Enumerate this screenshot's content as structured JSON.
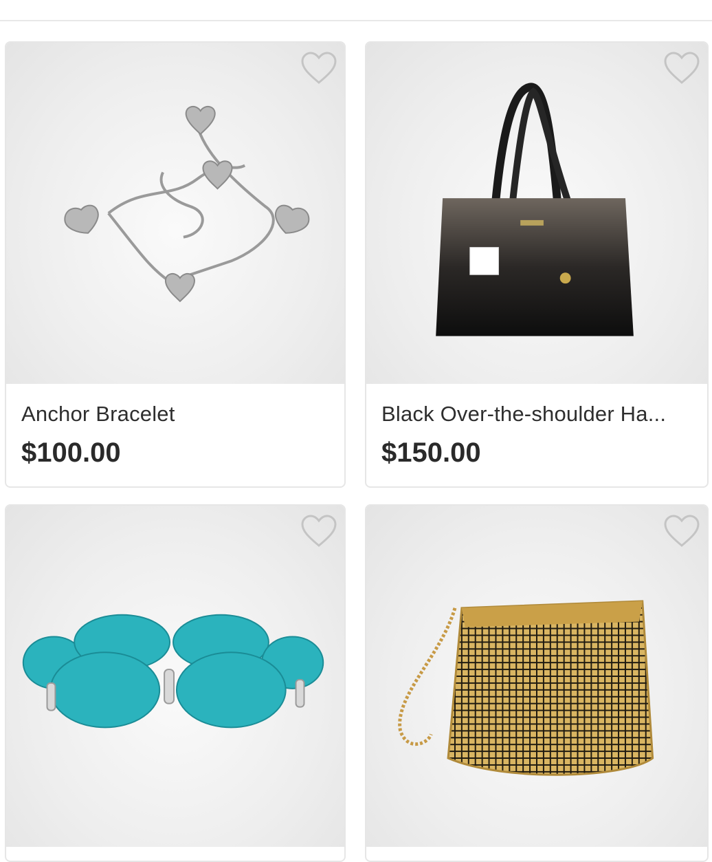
{
  "products": [
    {
      "name": "Anchor Bracelet",
      "price": "$100.00",
      "image": "silver heart charm bracelet",
      "favorite_icon": "heart-outline-icon"
    },
    {
      "name": "Black Over-the-shoulder Ha...",
      "price": "$150.00",
      "image": "black patent handbag",
      "favorite_icon": "heart-outline-icon"
    },
    {
      "name": "",
      "price": "",
      "image": "turquoise stone bracelet",
      "favorite_icon": "heart-outline-icon"
    },
    {
      "name": "",
      "price": "",
      "image": "gold mesh chain purse",
      "favorite_icon": "heart-outline-icon"
    }
  ],
  "colors": {
    "border": "#e6e6e6",
    "text": "#2e2e2e",
    "icon": "#c4c4c4"
  }
}
